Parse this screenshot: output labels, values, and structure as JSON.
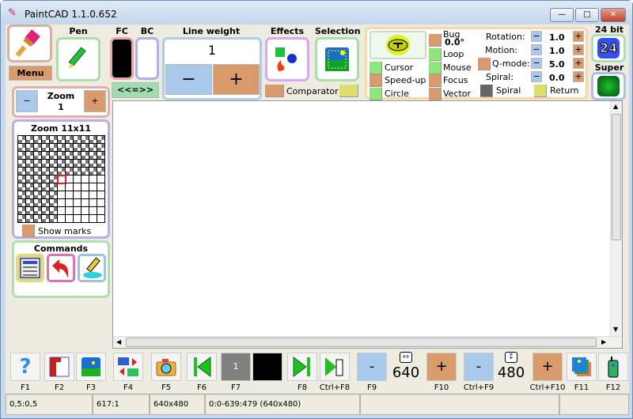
{
  "window": {
    "title": "PaintCAD 1.1.0.652",
    "minimize": "—",
    "maximize": "□",
    "close": "✕"
  },
  "top": {
    "menu_label": "Menu",
    "pen_label": "Pen",
    "fc_label": "FC",
    "bc_label": "BC",
    "swap_label": "<<=>>",
    "line_weight_label": "Line weight",
    "line_weight_value": "1",
    "minus": "−",
    "plus": "+",
    "effects_label": "Effects",
    "selection_label": "Selection",
    "comparator_label": "Comparator",
    "fc_color": "#000000",
    "bc_color": "#ffffff"
  },
  "control_panel": {
    "cursor": "Cursor",
    "speedup": "Speed-up",
    "circle": "Circle",
    "bug": "Bug",
    "bug_value": "0.0°",
    "loop": "Loop",
    "mouse": "Mouse",
    "focus": "Focus",
    "vector": "Vector",
    "rotation_label": "Rotation:",
    "rotation_value": "1.0",
    "motion_label": "Motion:",
    "motion_value": "1.0",
    "qmode_label": "Q-mode:",
    "qmode_value": "5.0",
    "spiral_label": "Spiral:",
    "spiral_value": "0.0",
    "spiral_check": "Spiral",
    "return_check": "Return",
    "minus": "−",
    "plus": "+"
  },
  "bit_depth": {
    "label": "24 bit",
    "value": "24"
  },
  "super": {
    "label": "Super"
  },
  "zoom": {
    "label": "Zoom",
    "value": "1",
    "minus": "−",
    "plus": "+"
  },
  "zoom_grid": {
    "label": "Zoom 11x11",
    "show_marks": "Show marks"
  },
  "commands": {
    "label": "Commands"
  },
  "toolbar": {
    "keys": [
      "F1",
      "F2",
      "F3",
      "F4",
      "F5",
      "F6",
      "F7",
      "F8",
      "Ctrl+F8",
      "F9",
      "F10",
      "Ctrl+F9",
      "Ctrl+F10",
      "F11",
      "F12"
    ],
    "frame_number": "1",
    "width_value": "640",
    "height_value": "480",
    "minus": "-",
    "plus": "+"
  },
  "status": [
    "0,5:0,5",
    "617:1",
    "640x480",
    "0:0-639:479 (640x480)",
    "",
    ""
  ],
  "colors": {
    "orange": "#d99a6c",
    "blue": "#a8c8ec",
    "green": "#8ee57a",
    "yellow": "#dede70",
    "accent_red": "#e02020"
  }
}
